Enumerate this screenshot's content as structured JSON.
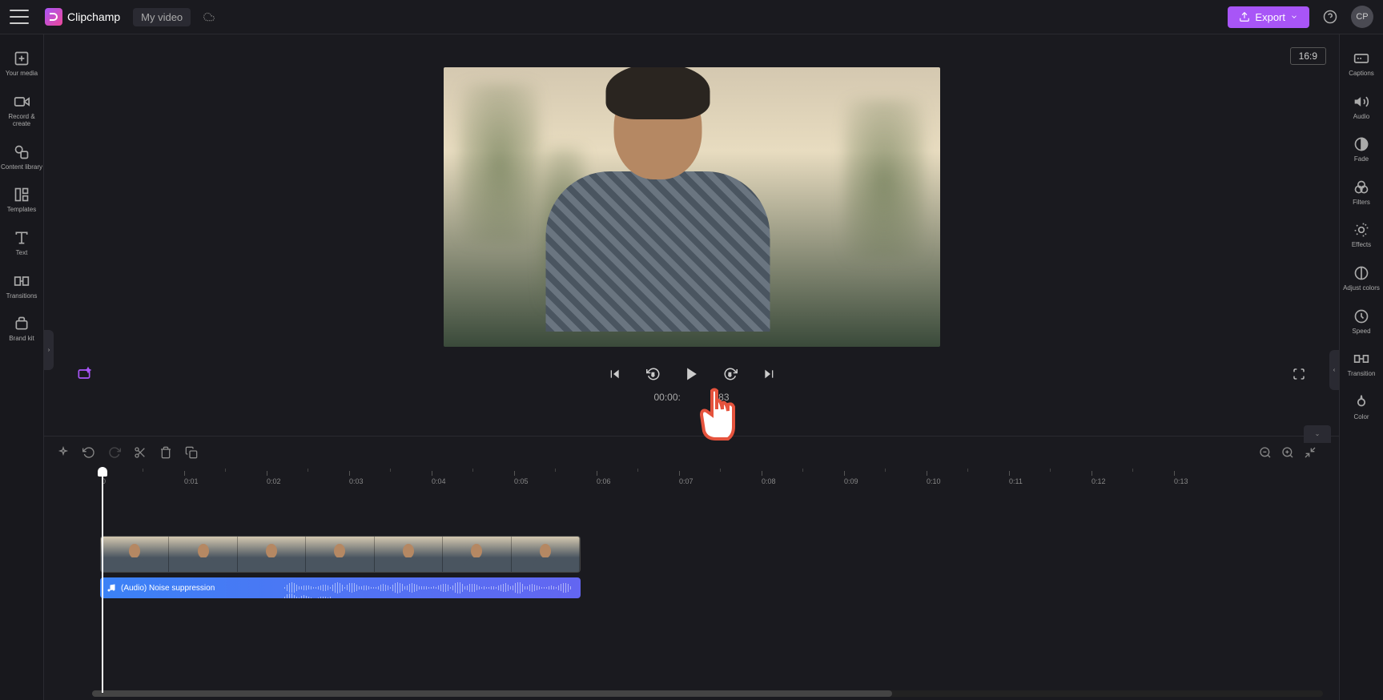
{
  "header": {
    "app_name": "Clipchamp",
    "project_name": "My video",
    "export_label": "Export",
    "avatar_initials": "CP"
  },
  "left_sidebar": {
    "items": [
      {
        "label": "Your media",
        "icon": "plus-box-icon"
      },
      {
        "label": "Record & create",
        "icon": "record-icon"
      },
      {
        "label": "Content library",
        "icon": "shapes-icon"
      },
      {
        "label": "Templates",
        "icon": "templates-icon"
      },
      {
        "label": "Text",
        "icon": "text-icon"
      },
      {
        "label": "Transitions",
        "icon": "transitions-icon"
      },
      {
        "label": "Brand kit",
        "icon": "brand-icon"
      }
    ]
  },
  "right_sidebar": {
    "items": [
      {
        "label": "Captions",
        "icon": "captions-icon"
      },
      {
        "label": "Audio",
        "icon": "audio-icon"
      },
      {
        "label": "Fade",
        "icon": "fade-icon"
      },
      {
        "label": "Filters",
        "icon": "filters-icon"
      },
      {
        "label": "Effects",
        "icon": "effects-icon"
      },
      {
        "label": "Adjust colors",
        "icon": "adjust-icon"
      },
      {
        "label": "Speed",
        "icon": "speed-icon"
      },
      {
        "label": "Transition",
        "icon": "transition-icon"
      },
      {
        "label": "Color",
        "icon": "color-icon"
      }
    ]
  },
  "preview": {
    "aspect_ratio": "16:9",
    "current_time": "00:00:",
    "duration_suffix": ".83"
  },
  "timeline": {
    "ruler": [
      "0",
      "0:01",
      "0:02",
      "0:03",
      "0:04",
      "0:05",
      "0:06",
      "0:07",
      "0:08",
      "0:09",
      "0:10",
      "0:11",
      "0:12",
      "0:13"
    ],
    "audio_track_label": "(Audio) Noise suppression"
  }
}
